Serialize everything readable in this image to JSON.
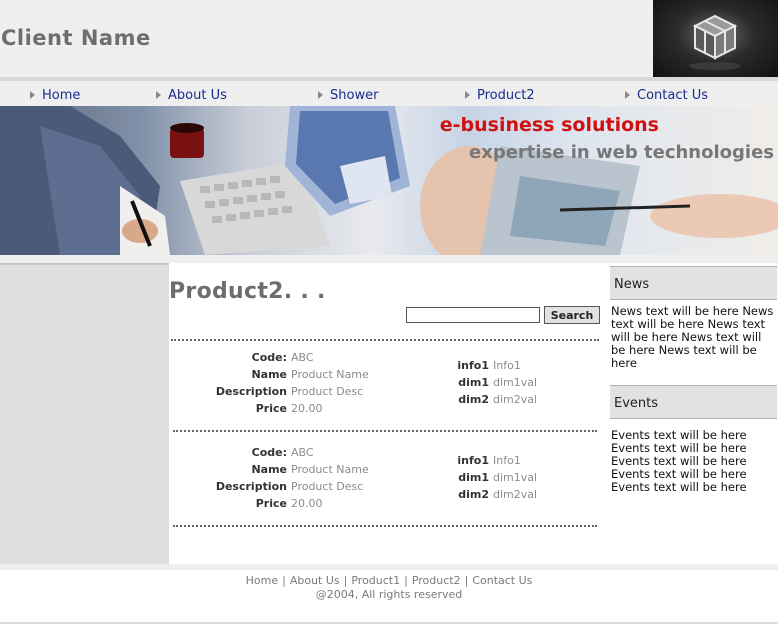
{
  "header": {
    "client_name": "Client Name"
  },
  "nav": {
    "items": [
      {
        "label": "Home"
      },
      {
        "label": "About Us"
      },
      {
        "label": "Shower"
      },
      {
        "label": "Product2"
      },
      {
        "label": "Contact Us"
      }
    ]
  },
  "banner": {
    "title": "e-business solutions",
    "subtitle": "expertise in web technologies"
  },
  "main": {
    "title": "Product2. . .",
    "search": {
      "value": "",
      "button_label": "Search"
    },
    "products": [
      {
        "left": [
          {
            "label": "Code:",
            "value": "ABC"
          },
          {
            "label": "Name",
            "value": "Product Name"
          },
          {
            "label": "Description",
            "value": "Product Desc"
          },
          {
            "label": "Price",
            "value": "20.00"
          }
        ],
        "right": [
          {
            "label": "info1",
            "value": "Info1"
          },
          {
            "label": "dim1",
            "value": "dim1val"
          },
          {
            "label": "dim2",
            "value": "dim2val"
          }
        ]
      },
      {
        "left": [
          {
            "label": "Code:",
            "value": "ABC"
          },
          {
            "label": "Name",
            "value": "Product Name"
          },
          {
            "label": "Description",
            "value": "Product Desc"
          },
          {
            "label": "Price",
            "value": "20.00"
          }
        ],
        "right": [
          {
            "label": "info1",
            "value": "Info1"
          },
          {
            "label": "dim1",
            "value": "dim1val"
          },
          {
            "label": "dim2",
            "value": "dim2val"
          }
        ]
      }
    ]
  },
  "sidebar": {
    "news": {
      "heading": "News",
      "text": "News text will be here News text will be here News text will be here News text will be here News text will be here"
    },
    "events": {
      "heading": "Events",
      "lines": [
        "Events text will be here",
        "Events text will be here",
        "Events text will be here",
        "Events text will be here",
        "Events text will be here"
      ]
    }
  },
  "footer": {
    "links": [
      {
        "label": "Home"
      },
      {
        "label": "About Us"
      },
      {
        "label": "Product1"
      },
      {
        "label": "Product2"
      },
      {
        "label": "Contact Us"
      }
    ],
    "separator": "|",
    "copyright": "@2004, All rights reserved"
  },
  "colors": {
    "nav_link": "#1a2c8c",
    "banner_title": "#d01010",
    "muted_value": "#8c8c8c"
  }
}
